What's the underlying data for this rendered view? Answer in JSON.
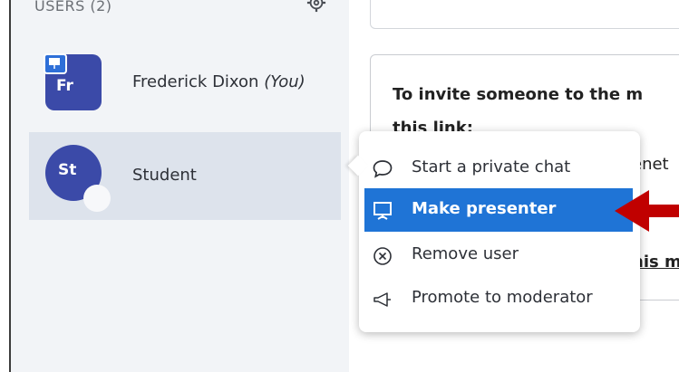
{
  "sidebar": {
    "header": "USERS (2)",
    "users": [
      {
        "initials": "Fr",
        "name": "Frederick Dixon",
        "you_tag": "(You)"
      },
      {
        "initials": "St",
        "name": "Student"
      }
    ]
  },
  "main": {
    "invite_line1": "To invite someone to the m",
    "invite_line2": "this link:",
    "link_fragment": "enet",
    "link_fragment2": "his m"
  },
  "context_menu": {
    "items": [
      {
        "label": "Start a private chat",
        "icon": "chat-bubble-icon"
      },
      {
        "label": "Make presenter",
        "icon": "presenter-screen-icon",
        "selected": true
      },
      {
        "label": "Remove user",
        "icon": "remove-circle-icon"
      },
      {
        "label": "Promote to moderator",
        "icon": "megaphone-icon"
      }
    ]
  },
  "colors": {
    "accent": "#1f74d6",
    "avatar": "#3b4aa8",
    "arrow": "#c00000",
    "sidebar_bg": "#f2f4f7",
    "selected_row": "#dde3ec"
  }
}
